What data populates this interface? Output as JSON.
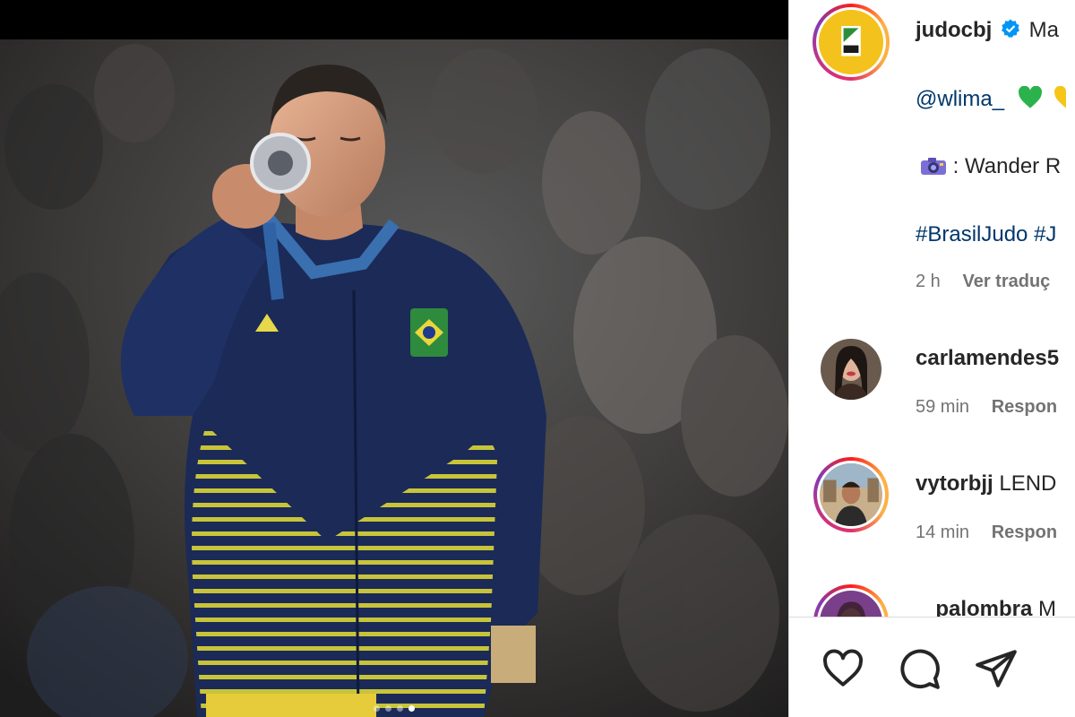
{
  "post": {
    "author": "judocbj",
    "caption_start": "Ma",
    "mention": "@wlima_",
    "credit_prefix": ": Wander R",
    "hashtags": "#BrasilJudo #J",
    "time": "2 h",
    "see_translation": "Ver traduç"
  },
  "comments": [
    {
      "user": "carlamendes5",
      "text": "",
      "time": "59 min",
      "reply": "Respon"
    },
    {
      "user": "vytorbjj",
      "text": "LEND",
      "time": "14 min",
      "reply": "Respon"
    },
    {
      "user": "_palombra",
      "text": "M"
    }
  ],
  "icons": {
    "like": "heart-icon",
    "comment": "comment-bubble-icon",
    "share": "paper-plane-icon",
    "verified": "verified-badge-icon",
    "green_heart": "green-heart-emoji",
    "camera": "camera-emoji"
  },
  "colors": {
    "link": "#00376b",
    "secondary_text": "#737373",
    "verified": "#0095f6",
    "jacket": "#1a2a5c",
    "jacket_stripe": "#c8c43a"
  },
  "carousel": {
    "current": 3,
    "total": 4
  }
}
